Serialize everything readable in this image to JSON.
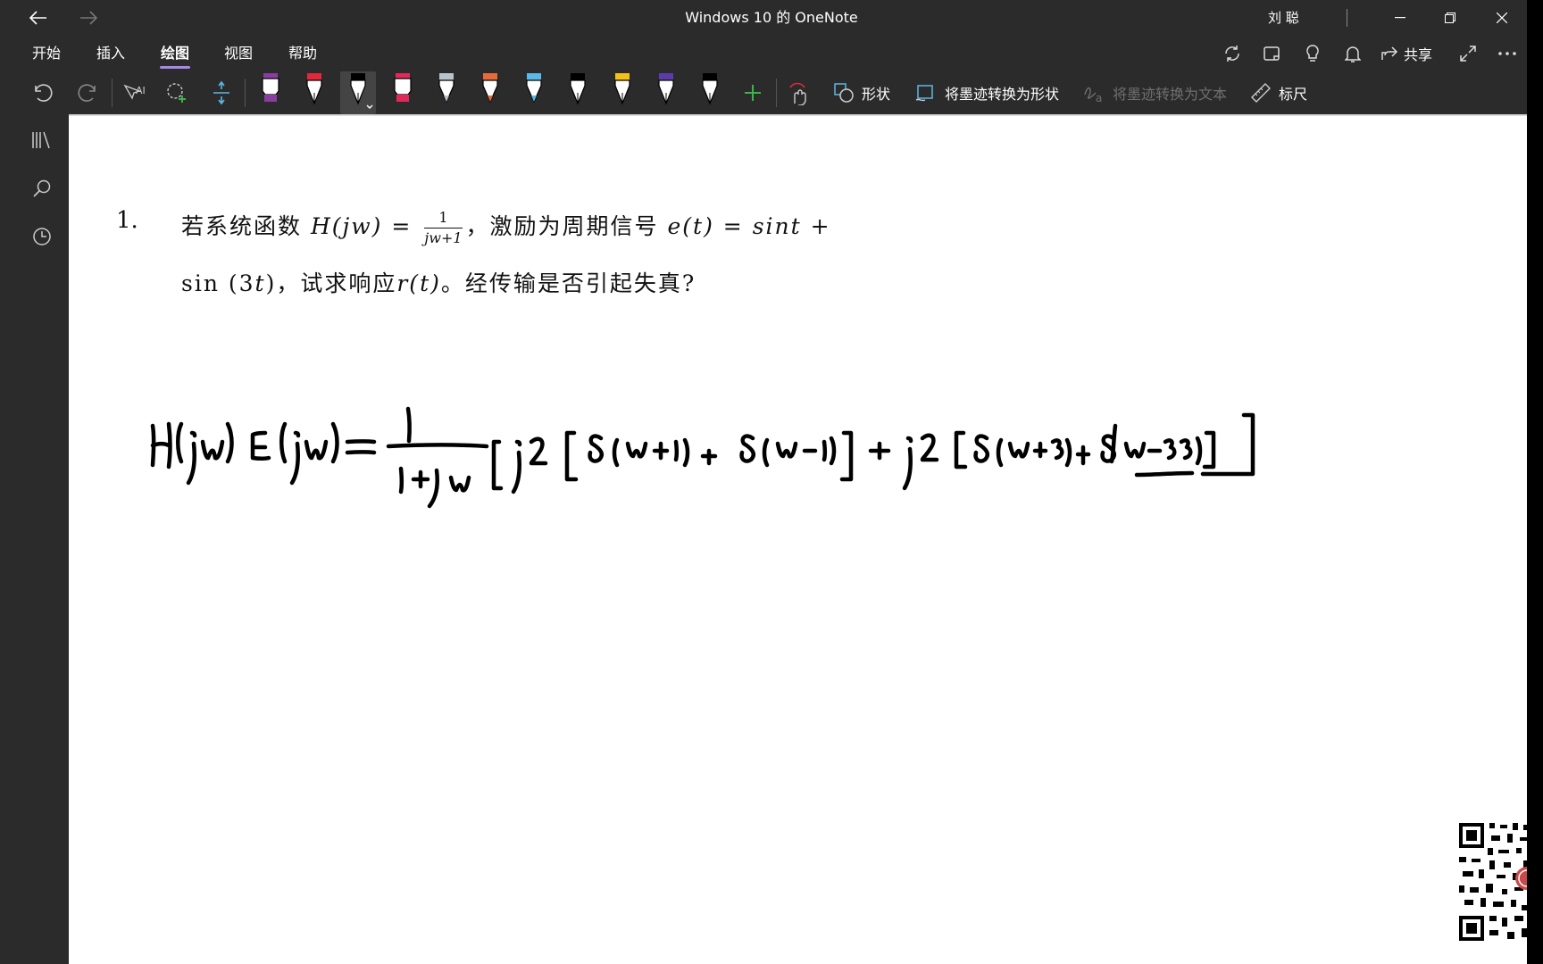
{
  "window": {
    "title": "Windows 10 的 OneNote",
    "user": "刘 聪"
  },
  "menu": {
    "items": [
      "开始",
      "插入",
      "绘图",
      "视图",
      "帮助"
    ],
    "active": "绘图",
    "share_label": "共享"
  },
  "toolbar": {
    "shapes_label": "形状",
    "ink_to_shape_label": "将墨迹转换为形状",
    "ink_to_text_label": "将墨迹转换为文本",
    "ruler_label": "标尺",
    "pens": [
      {
        "color": "#8a3da0",
        "kind": "highlighter"
      },
      {
        "color": "#e2283d",
        "kind": "pen"
      },
      {
        "color": "#000000",
        "kind": "pen",
        "selected": true
      },
      {
        "color": "#e02a5a",
        "kind": "highlighter"
      },
      {
        "color": "#b8c4cc",
        "kind": "pencil"
      },
      {
        "color": "#e66a3a",
        "kind": "pencil"
      },
      {
        "color": "#5cb8e6",
        "kind": "pencil"
      },
      {
        "color": "#000000",
        "kind": "pen"
      },
      {
        "color": "#f2c21b",
        "kind": "pen"
      },
      {
        "color": "#5a3da8",
        "kind": "pen"
      },
      {
        "color": "#000000",
        "kind": "pen"
      }
    ],
    "add_pen_color": "#3db34a"
  },
  "page": {
    "question_number": "1.",
    "line1_a": "若系统函数",
    "line1_H": "H(jw) =",
    "frac_num": "1",
    "frac_den": "jw+1",
    "line1_b": "，激励为周期信号",
    "line1_e": "e(t) = sint +",
    "line2_a": "sin (3",
    "line2_t": "t",
    "line2_b": ")，试求响应",
    "line2_r": "r(t)",
    "line2_c": "。经传输是否引起失真?"
  },
  "colors": {
    "chrome_bg": "#2b2b2b",
    "accent": "#a688e8",
    "canvas_bg": "#ffffff"
  }
}
